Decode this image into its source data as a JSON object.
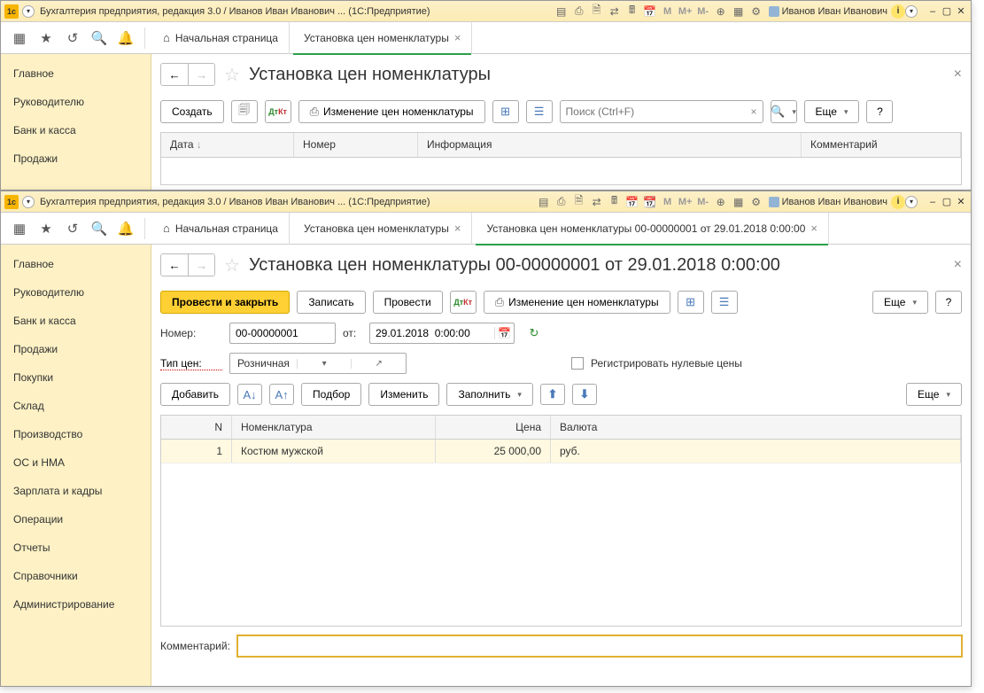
{
  "window1": {
    "title": "Бухгалтерия предприятия, редакция 3.0 / Иванов Иван Иванович ... (1С:Предприятие)",
    "user": "Иванов Иван Иванович",
    "tabs": {
      "home": "Начальная страница",
      "tab1": "Установка цен номенклатуры"
    },
    "sidebar": [
      "Главное",
      "Руководителю",
      "Банк и касса",
      "Продажи"
    ],
    "page_title": "Установка цен номенклатуры",
    "actions": {
      "create": "Создать",
      "change_prices": "Изменение цен номенклатуры",
      "search_placeholder": "Поиск (Ctrl+F)",
      "more": "Еще"
    },
    "grid_cols": {
      "date": "Дата",
      "number": "Номер",
      "info": "Информация",
      "comment": "Комментарий"
    }
  },
  "window2": {
    "title": "Бухгалтерия предприятия, редакция 3.0 / Иванов Иван Иванович ... (1С:Предприятие)",
    "user": "Иванов Иван Иванович",
    "tabs": {
      "home": "Начальная страница",
      "tab1": "Установка цен номенклатуры",
      "tab2": "Установка цен номенклатуры 00-00000001 от 29.01.2018 0:00:00"
    },
    "sidebar": [
      "Главное",
      "Руководителю",
      "Банк и касса",
      "Продажи",
      "Покупки",
      "Склад",
      "Производство",
      "ОС и НМА",
      "Зарплата и кадры",
      "Операции",
      "Отчеты",
      "Справочники",
      "Администрирование"
    ],
    "page_title": "Установка цен номенклатуры 00-00000001 от 29.01.2018 0:00:00",
    "actions": {
      "post_close": "Провести и закрыть",
      "save": "Записать",
      "post": "Провести",
      "change_prices": "Изменение цен номенклатуры",
      "more": "Еще",
      "add": "Добавить",
      "select": "Подбор",
      "edit": "Изменить",
      "fill": "Заполнить"
    },
    "form": {
      "number_label": "Номер:",
      "number_value": "00-00000001",
      "from_label": "от:",
      "date_value": "29.01.2018  0:00:00",
      "price_type_label": "Тип цен:",
      "price_type_value": "Розничная",
      "register_zero_label": "Регистрировать нулевые цены",
      "comment_label": "Комментарий:"
    },
    "table": {
      "cols": {
        "n": "N",
        "nom": "Номенклатура",
        "price": "Цена",
        "cur": "Валюта"
      },
      "rows": [
        {
          "n": "1",
          "nom": "Костюм мужской",
          "price": "25 000,00",
          "cur": "руб."
        }
      ]
    }
  }
}
